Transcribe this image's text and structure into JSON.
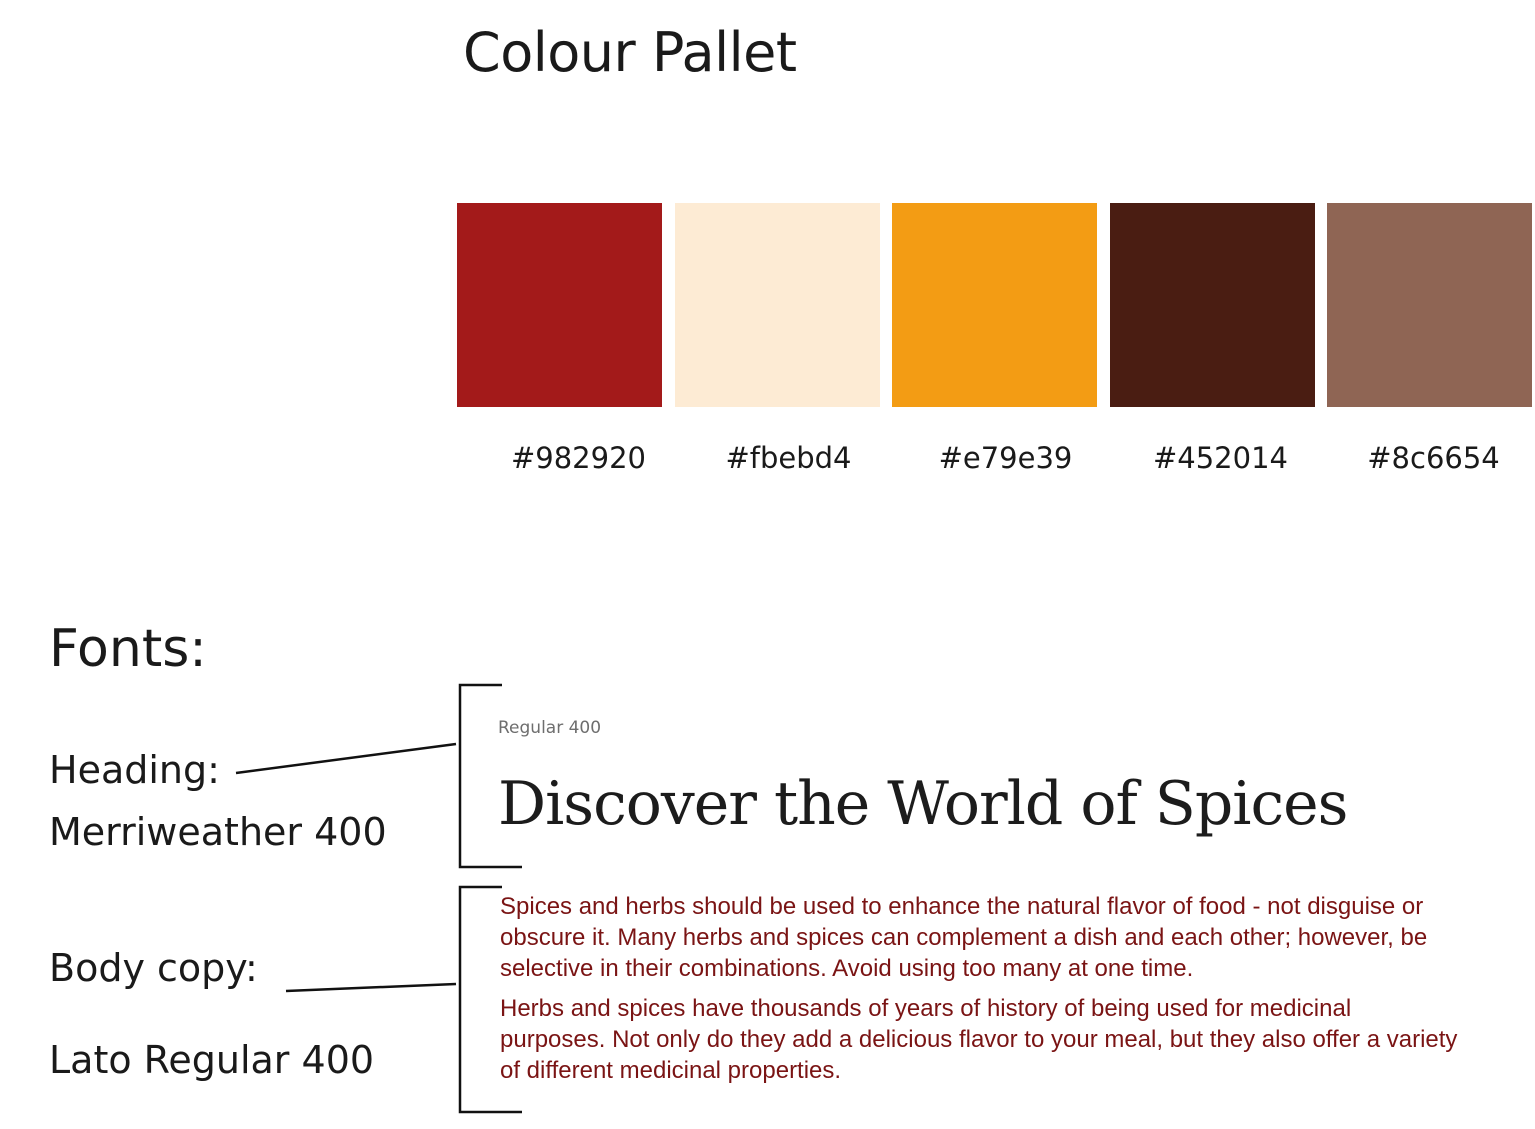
{
  "title": "Colour Pallet",
  "palette": [
    {
      "hex": "#982920",
      "color": "#a31a1a"
    },
    {
      "hex": "#fbebd4",
      "color": "#fdebd4"
    },
    {
      "hex": "#e79e39",
      "color": "#f39c14"
    },
    {
      "hex": "#452014",
      "color": "#4a1d12"
    },
    {
      "hex": "#8c6654",
      "color": "#8f6554"
    }
  ],
  "fonts": {
    "title": "Fonts:",
    "heading": {
      "label": "Heading:",
      "font": "Merriweather 400"
    },
    "body": {
      "label": "Body copy:",
      "font": "Lato Regular 400"
    }
  },
  "sample": {
    "weight_caption": "Regular 400",
    "heading": "Discover the World of Spices",
    "paragraphs": [
      "Spices and herbs should be used to enhance the natural flavor of food - not disguise or obscure it. Many herbs and spices can complement a dish and each other; however, be selective in their combinations. Avoid using too many at one time.",
      "Herbs and spices have thousands of years of history of being used for medicinal purposes. Not only do they add a delicious flavor to your meal, but they also offer a variety of different medicinal properties."
    ]
  }
}
